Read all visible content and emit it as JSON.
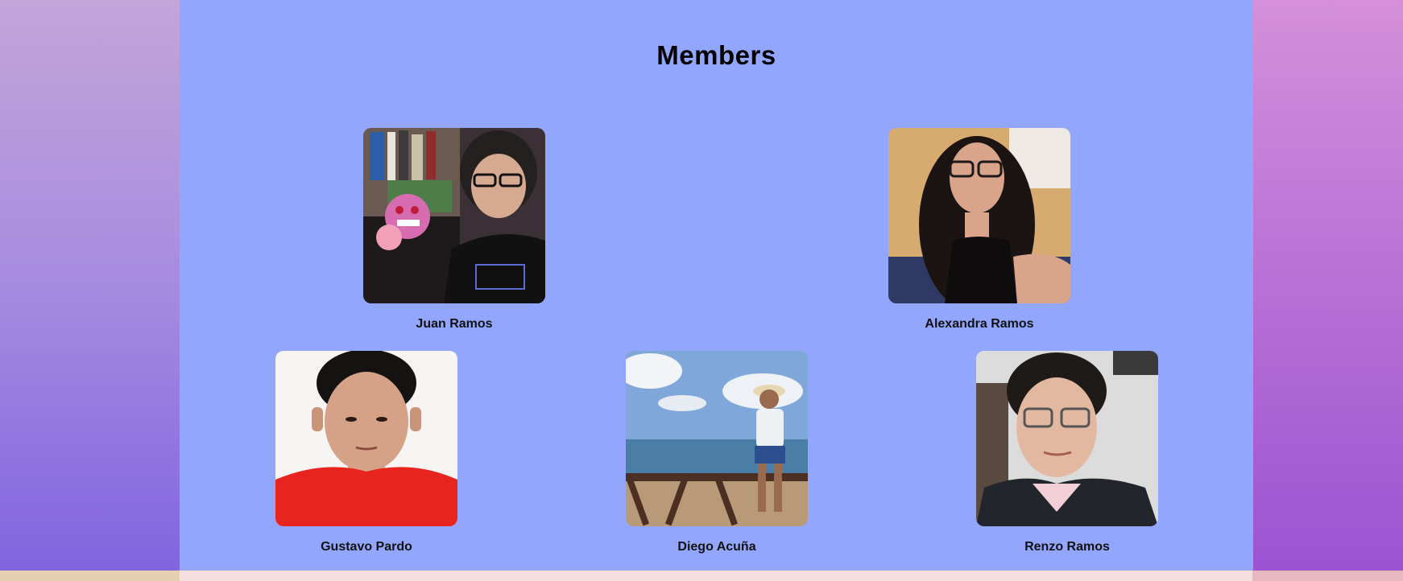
{
  "section": {
    "title": "Members"
  },
  "members": [
    {
      "name": "Juan Ramos"
    },
    {
      "name": "Alexandra Ramos"
    },
    {
      "name": "Gustavo Pardo"
    },
    {
      "name": "Diego Acuña"
    },
    {
      "name": "Renzo Ramos"
    }
  ]
}
